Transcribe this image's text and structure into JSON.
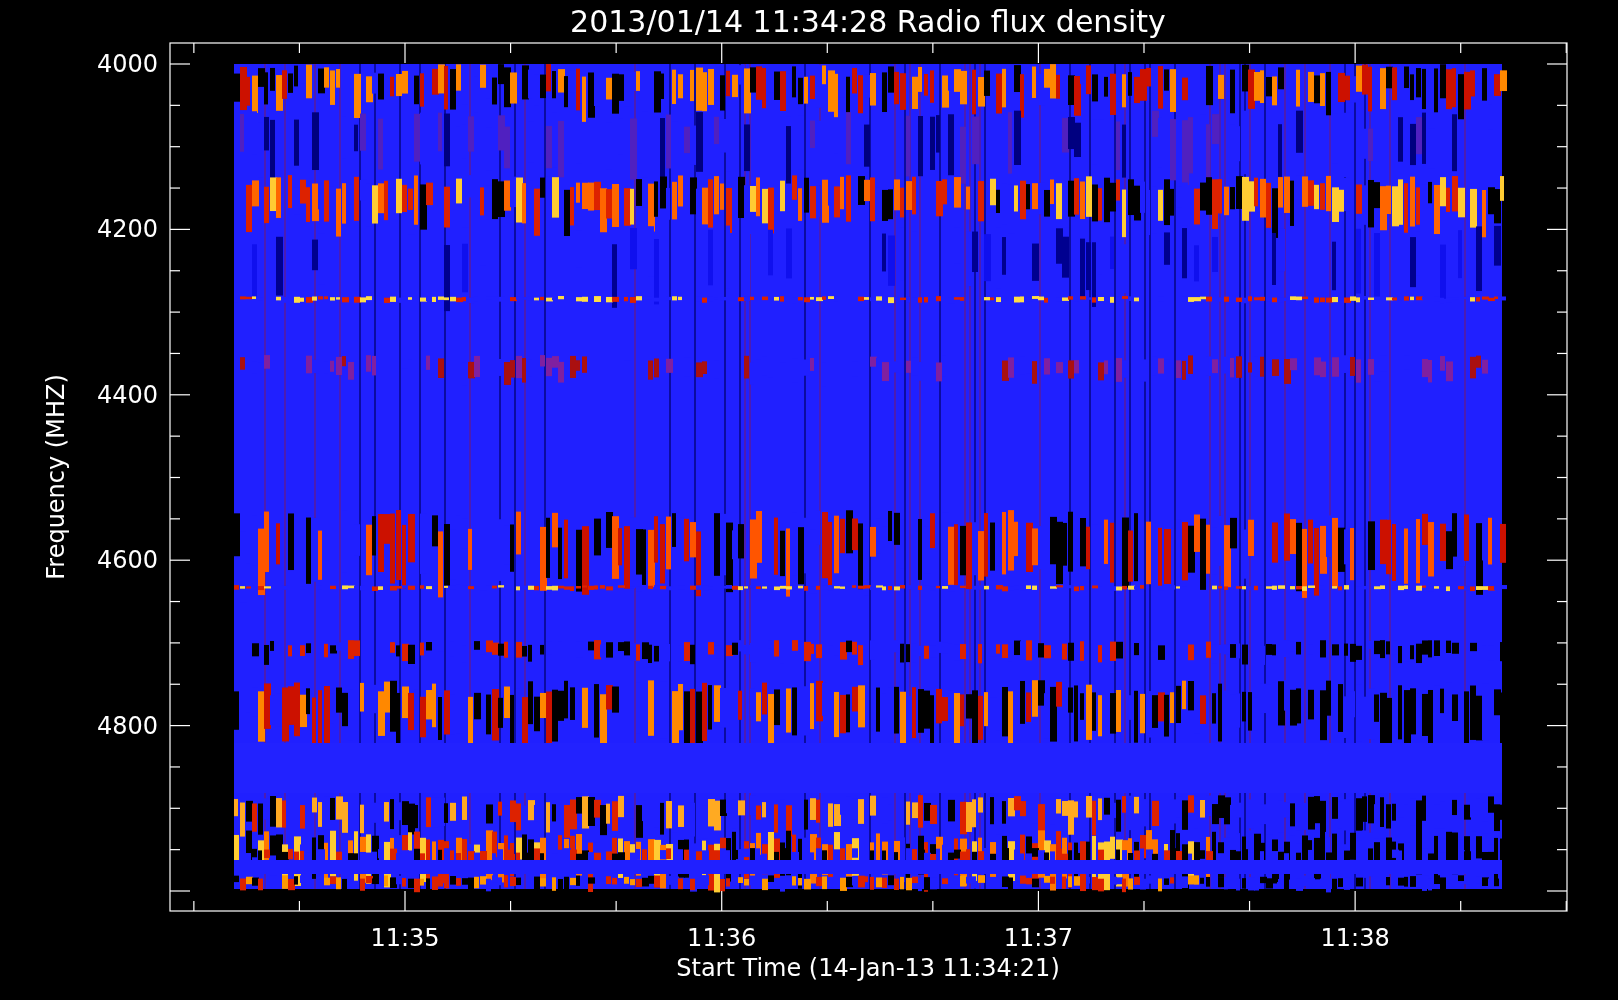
{
  "title": "2013/01/14 11:34:28 Radio flux density",
  "y_axis": {
    "label": "Frequency (MHZ)",
    "ticks": [
      "4000",
      "4200",
      "4400",
      "4600",
      "4800"
    ]
  },
  "x_axis": {
    "label": "Start Time (14-Jan-13 11:34:21)",
    "ticks": [
      "11:35",
      "11:36",
      "11:37",
      "11:38"
    ]
  }
}
